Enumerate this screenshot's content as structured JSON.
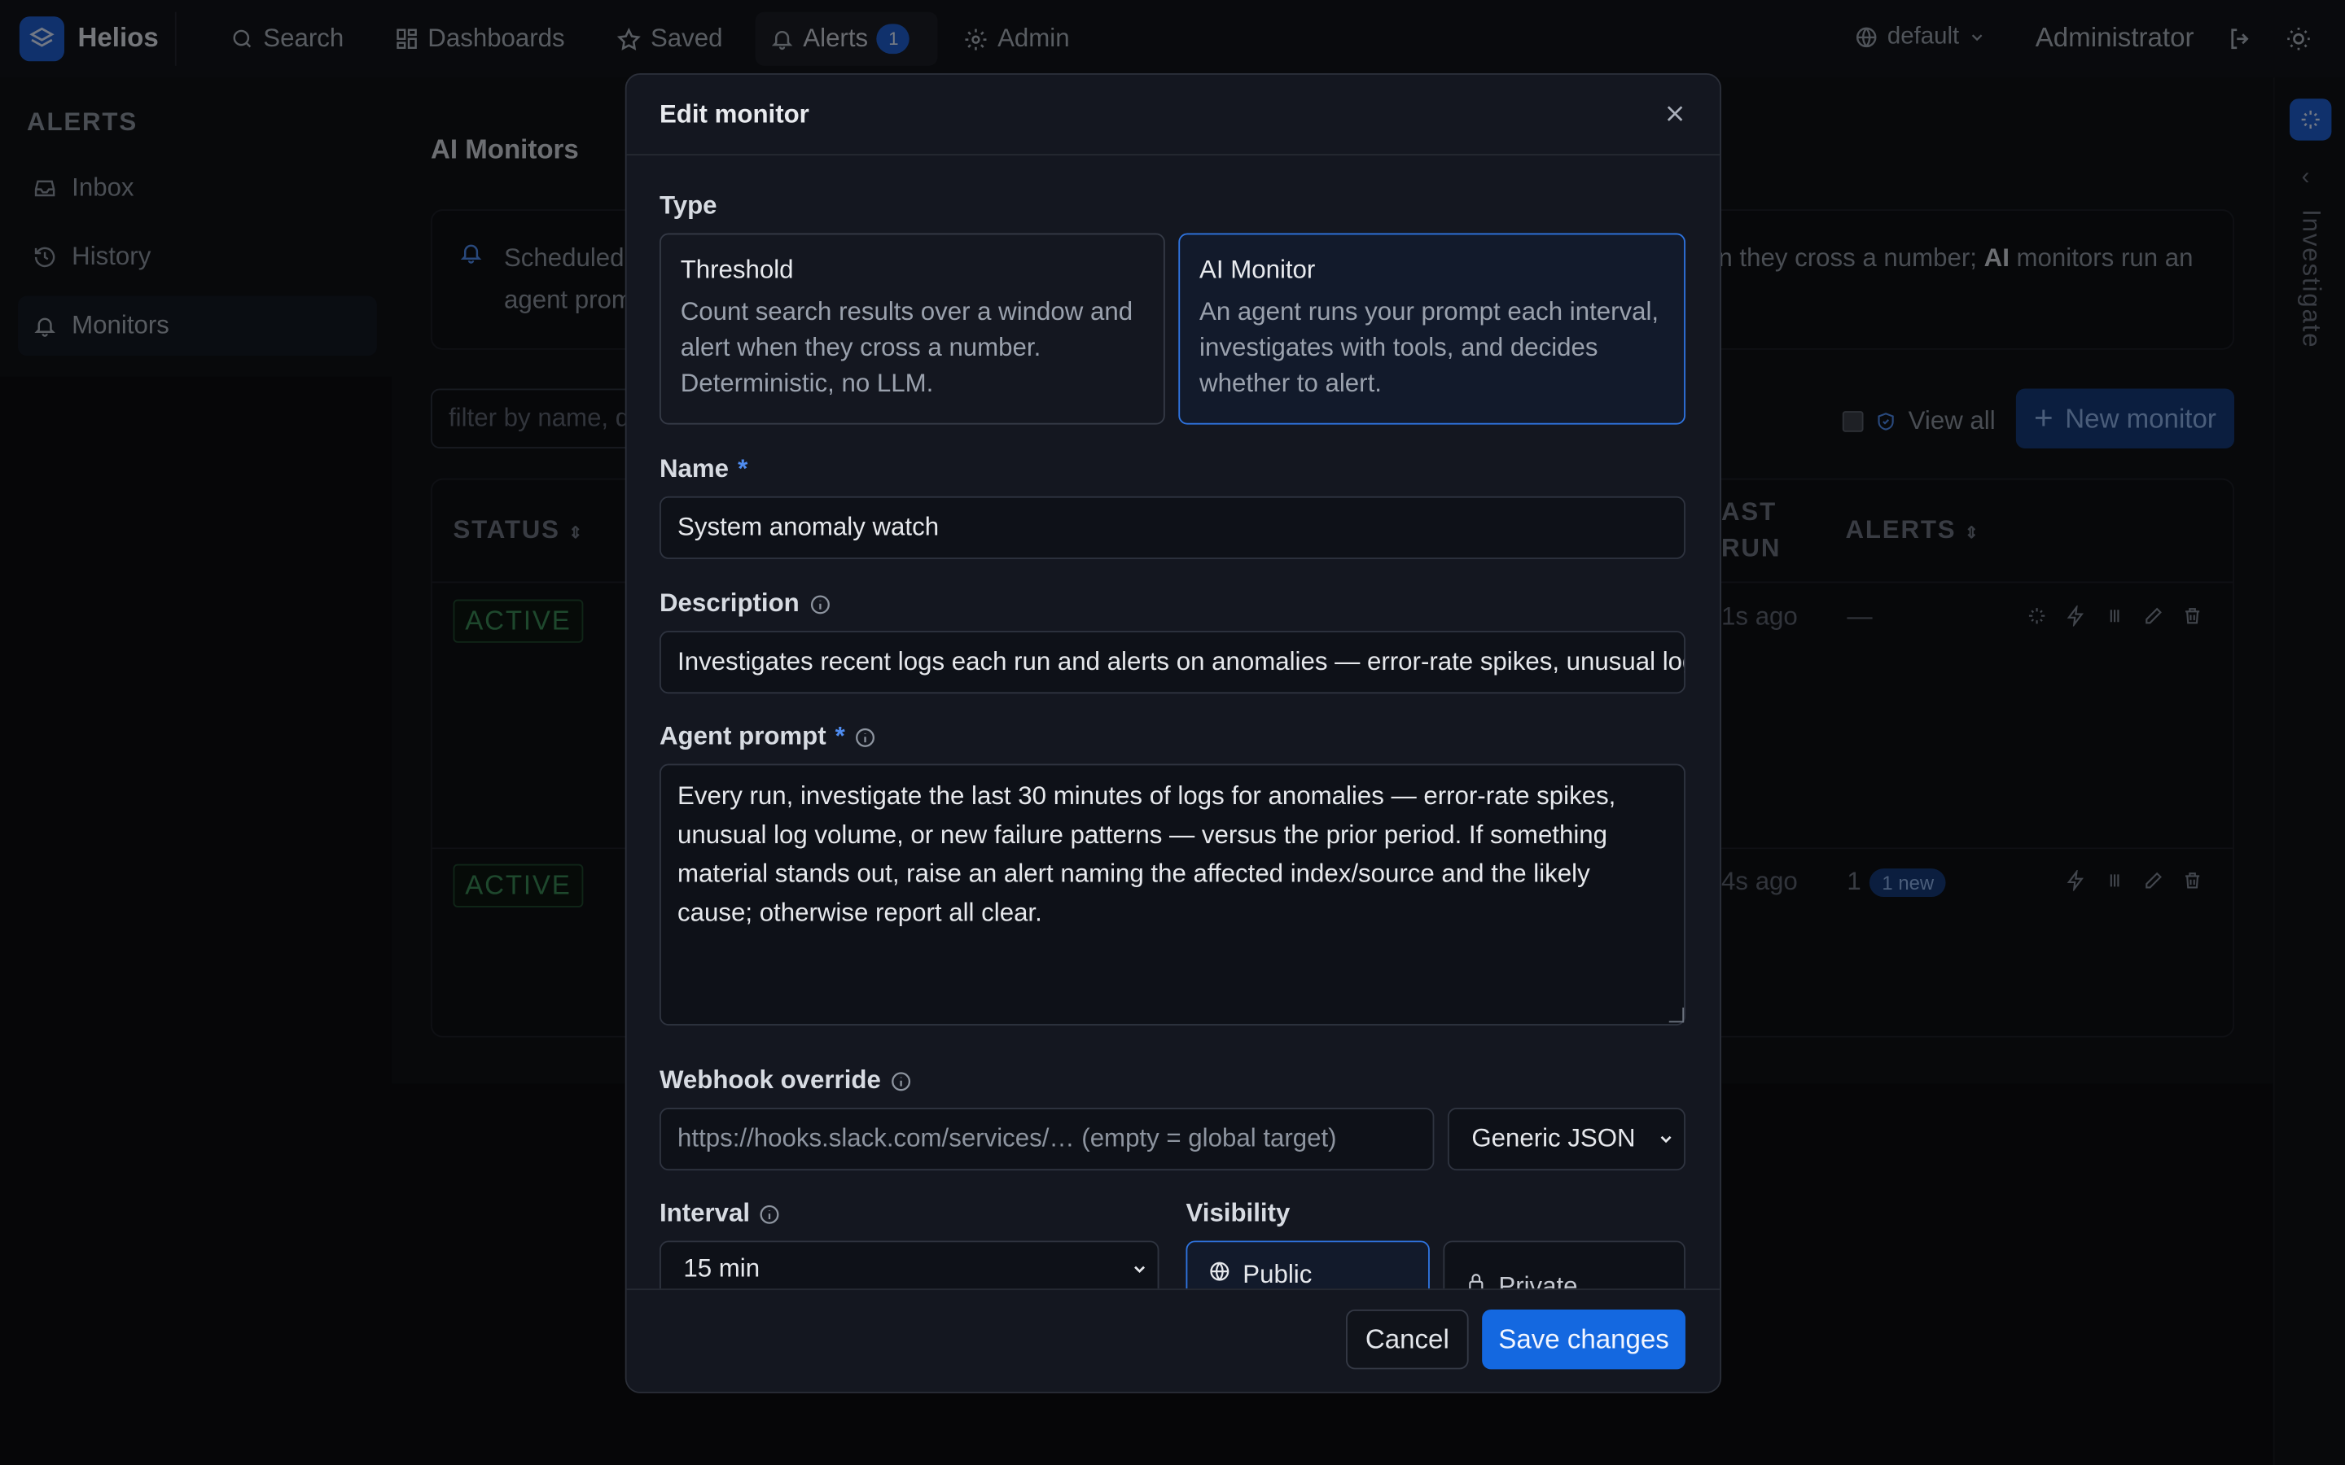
{
  "app": {
    "name": "Helios"
  },
  "nav": {
    "search": "Search",
    "dashboards": "Dashboards",
    "saved": "Saved",
    "alerts": "Alerts",
    "alerts_badge": "1",
    "admin": "Admin",
    "workspace": "default",
    "user": "Administrator"
  },
  "sidebar": {
    "heading": "ALERTS",
    "items": [
      {
        "label": "Inbox",
        "icon": "inbox-icon"
      },
      {
        "label": "History",
        "icon": "history-icon"
      },
      {
        "label": "Monitors",
        "icon": "bell-icon"
      }
    ]
  },
  "main": {
    "title": "AI Monitors",
    "info_left": "Scheduled",
    "info_left2": "agent prom",
    "info_right_a": "n they cross a number; ",
    "info_right_b": "AI",
    "info_right_c": " monitors run an",
    "filter_placeholder": "filter by name, d",
    "view_all": "View all",
    "new_monitor": "New monitor",
    "columns": {
      "status": "STATUS",
      "last_run_1": "AST",
      "last_run_2": "RUN",
      "alerts": "ALERTS"
    },
    "rows": [
      {
        "status": "ACTIVE",
        "last_run": "1s ago",
        "alerts": "—",
        "new_badge": ""
      },
      {
        "status": "ACTIVE",
        "last_run": "4s ago",
        "alerts": "1",
        "new_badge": "1 new"
      }
    ]
  },
  "right_rail": {
    "label": "Investigate"
  },
  "modal": {
    "title": "Edit monitor",
    "type_label": "Type",
    "types": [
      {
        "title": "Threshold",
        "desc": "Count search results over a window and alert when they cross a number. Deterministic, no LLM."
      },
      {
        "title": "AI Monitor",
        "desc": "An agent runs your prompt each interval, investigates with tools, and decides whether to alert."
      }
    ],
    "name_label": "Name",
    "name_value": "System anomaly watch",
    "description_label": "Description",
    "description_value": "Investigates recent logs each run and alerts on anomalies — error-rate spikes, unusual log volume, or new failure patterns",
    "prompt_label": "Agent prompt",
    "prompt_value": "Every run, investigate the last 30 minutes of logs for anomalies — error-rate spikes, unusual log volume, or new failure patterns — versus the prior period. If something material stands out, raise an alert naming the affected index/source and the likely cause; otherwise report all clear.",
    "webhook_label": "Webhook override",
    "webhook_placeholder": "https://hooks.slack.com/services/… (empty = global target)",
    "webhook_format": "Generic JSON",
    "interval_label": "Interval",
    "interval_value": "15 min",
    "visibility_label": "Visibility",
    "visibility_public": "Public",
    "visibility_private": "Private",
    "required_mark": "*",
    "cancel": "Cancel",
    "save": "Save changes"
  },
  "colors": {
    "accent": "#1f5fcf",
    "active_green": "#3b8a57",
    "bg": "#0c0d10"
  }
}
